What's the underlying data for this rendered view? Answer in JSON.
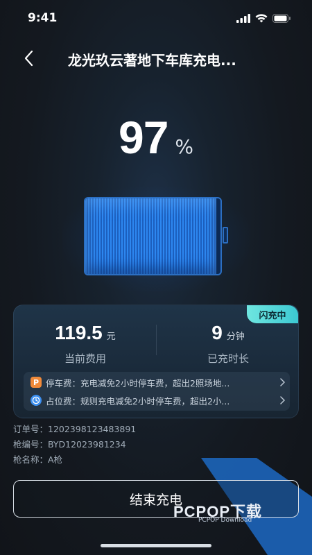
{
  "status_bar": {
    "time": "9:41"
  },
  "header": {
    "title": "龙光玖云著地下车库充电..."
  },
  "charge": {
    "percent_value": "97",
    "percent_unit": "%",
    "battery_level": 0.97
  },
  "card": {
    "badge": "闪充中",
    "fee_value": "119.5",
    "fee_unit": "元",
    "fee_label": "当前费用",
    "duration_value": "9",
    "duration_unit": "分钟",
    "duration_label": "已充时长",
    "rows": [
      {
        "icon": "parking-icon",
        "icon_text": "P",
        "text": "停车费：充电减免2小时停车费，超出2照场地..."
      },
      {
        "icon": "clock-icon",
        "text": "占位费：规则充电减免2小时停车费，超出2小..."
      }
    ]
  },
  "order": {
    "order_no": "订单号：1202398123483891",
    "gun_no": "枪编号：BYD12023981234",
    "gun_name": "枪名称：A枪"
  },
  "actions": {
    "end_label": "结束充电"
  },
  "watermark": {
    "text": "PCPOP下载",
    "sub": "PCPOP Download"
  },
  "colors": {
    "accent": "#2d87f0",
    "badge": "#4fd3d8",
    "parking_icon": "#f08a3a",
    "clock_icon": "#3c8ff0"
  }
}
